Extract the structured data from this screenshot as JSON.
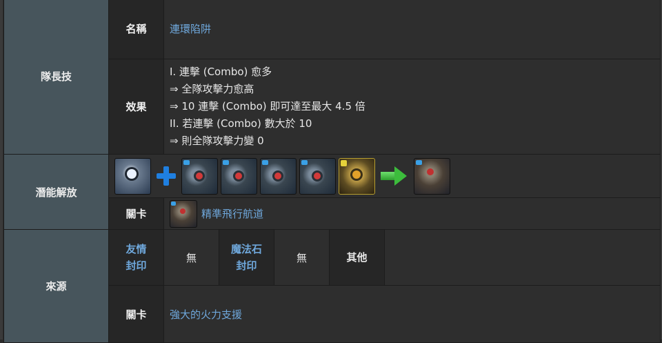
{
  "leader_skill": {
    "section": "隊長技",
    "name_label": "名稱",
    "name_value": "連環陷阱",
    "effect_label": "效果",
    "effect_lines": [
      "I. 連擊 (Combo) 愈多",
      "⇒ 全隊攻擊力愈高",
      "⇒ 10 連擊 (Combo) 即可達至最大 4.5 倍",
      "II. 若連擊 (Combo) 數大於 10",
      "⇒ 則全隊攻擊力變 0"
    ]
  },
  "potential": {
    "section": "潛能解放",
    "materials": [
      {
        "icon": "blue-robot-card-icon"
      },
      {
        "icon": "plus-icon"
      },
      {
        "icon": "red-eye-robot-card-icon"
      },
      {
        "icon": "red-eye-robot-card-icon"
      },
      {
        "icon": "red-eye-robot-card-icon"
      },
      {
        "icon": "red-eye-robot-card-icon"
      },
      {
        "icon": "gold-robot-card-icon"
      },
      {
        "icon": "green-arrow-icon"
      },
      {
        "icon": "evolved-robot-card-icon"
      }
    ],
    "stage_label": "關卡",
    "stage_value": "精準飛行航道"
  },
  "source": {
    "section": "來源",
    "friend_label_1": "友情",
    "friend_label_2": "封印",
    "friend_value": "無",
    "magic_label_1": "魔法石",
    "magic_label_2": "封印",
    "magic_value": "無",
    "other_label": "其他",
    "stage_label": "關卡",
    "stage_value": "強大的火力支援"
  },
  "colors": {
    "link": "#6fa8dc",
    "section_bg": "#47555c",
    "label_bg": "#262626",
    "value_bg": "#2e2e2e"
  }
}
